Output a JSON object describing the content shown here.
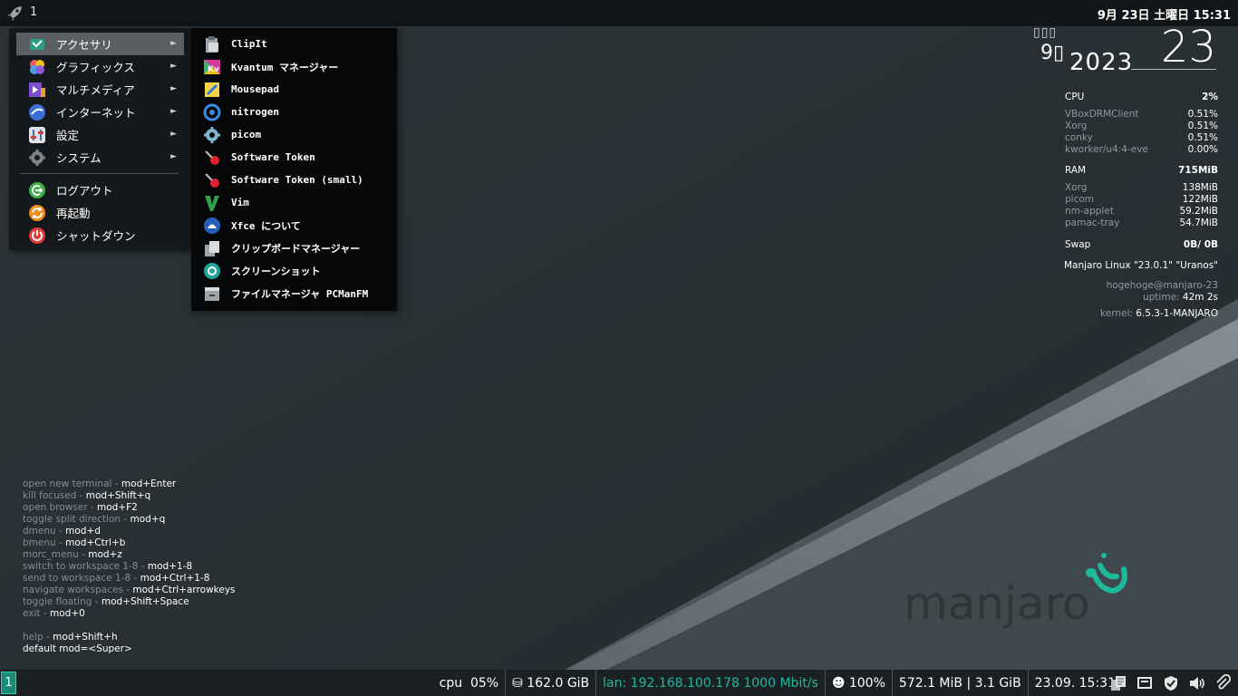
{
  "top_panel": {
    "workspace": "1",
    "clock": "9月 23日 土曜日 15:31"
  },
  "main_menu": {
    "categories": [
      {
        "label": "アクセサリ",
        "icon": "accessories-icon"
      },
      {
        "label": "グラフィックス",
        "icon": "graphics-icon"
      },
      {
        "label": "マルチメディア",
        "icon": "multimedia-icon"
      },
      {
        "label": "インターネット",
        "icon": "internet-icon"
      },
      {
        "label": "設定",
        "icon": "settings-icon"
      },
      {
        "label": "システム",
        "icon": "system-icon"
      }
    ],
    "actions": [
      {
        "label": "ログアウト",
        "icon": "logout-icon"
      },
      {
        "label": "再起動",
        "icon": "restart-icon"
      },
      {
        "label": "シャットダウン",
        "icon": "shutdown-icon"
      }
    ],
    "arrow": "►"
  },
  "sub_menu": {
    "items": [
      {
        "label": "ClipIt",
        "icon": "clipit-icon"
      },
      {
        "label": "Kvantum マネージャー",
        "icon": "kvantum-icon"
      },
      {
        "label": "Mousepad",
        "icon": "mousepad-icon"
      },
      {
        "label": "nitrogen",
        "icon": "nitrogen-icon"
      },
      {
        "label": "picom",
        "icon": "picom-icon"
      },
      {
        "label": "Software Token",
        "icon": "software-token-icon"
      },
      {
        "label": "Software Token (small)",
        "icon": "software-token-small-icon"
      },
      {
        "label": "Vim",
        "icon": "vim-icon"
      },
      {
        "label": "Xfce について",
        "icon": "xfce-icon"
      },
      {
        "label": "クリップボードマネージャー",
        "icon": "clipboard-manager-icon"
      },
      {
        "label": "スクリーンショット",
        "icon": "screenshot-icon"
      },
      {
        "label": "ファイルマネージャ PCManFM",
        "icon": "file-manager-icon"
      }
    ]
  },
  "conky": {
    "date_boxes": "▯▯▯",
    "month": "9▯",
    "year": "2023",
    "day": "23",
    "cpu": {
      "label": "CPU",
      "value": "2%",
      "procs": [
        {
          "name": "VBoxDRMClient",
          "value": "0.51%"
        },
        {
          "name": "Xorg",
          "value": "0.51%"
        },
        {
          "name": "conky",
          "value": "0.51%"
        },
        {
          "name": "kworker/u4:4-eve",
          "value": "0.00%"
        }
      ]
    },
    "ram": {
      "label": "RAM",
      "value": "715MiB",
      "procs": [
        {
          "name": "Xorg",
          "value": "138MiB"
        },
        {
          "name": "picom",
          "value": "122MiB"
        },
        {
          "name": "nm-applet",
          "value": "59.2MiB"
        },
        {
          "name": "pamac-tray",
          "value": "54.7MiB"
        }
      ]
    },
    "swap": {
      "label": "Swap",
      "value": "0B/ 0B"
    },
    "os": "Manjaro Linux \"23.0.1\" \"Uranos\"",
    "user": "hogehoge@manjaro-23",
    "uptime_label": "uptime:",
    "uptime": "42m 2s",
    "kernel_label": "kernel:",
    "kernel": "6.5.3-1-MANJARO"
  },
  "help": {
    "lines": [
      {
        "k": "open new terminal - ",
        "v": "mod+Enter"
      },
      {
        "k": "kill focused - ",
        "v": "mod+Shift+q"
      },
      {
        "k": "open browser - ",
        "v": "mod+F2"
      },
      {
        "k": "toggle split direction - ",
        "v": "mod+q"
      },
      {
        "k": "dmenu - ",
        "v": "mod+d"
      },
      {
        "k": "bmenu - ",
        "v": "mod+Ctrl+b"
      },
      {
        "k": "morc_menu - ",
        "v": "mod+z"
      },
      {
        "k": "switch to workspace 1-8 - ",
        "v": "mod+1-8"
      },
      {
        "k": "send to workspace 1-8 - ",
        "v": "mod+Ctrl+1-8"
      },
      {
        "k": "navigate workspaces - ",
        "v": "mod+Ctrl+arrowkeys"
      },
      {
        "k": "toggle floating - ",
        "v": "mod+Shift+Space"
      },
      {
        "k": "exit - ",
        "v": "mod+0"
      },
      {
        "k": "",
        "v": ""
      },
      {
        "k": "help - ",
        "v": "mod+Shift+h"
      },
      {
        "k": "",
        "v": "default mod=<Super>"
      }
    ]
  },
  "bottom_bar": {
    "workspace": "1",
    "cpu": "cpu  05%",
    "disk": "⛁ 162.0 GiB",
    "lan": "lan: 192.168.100.178 1000 Mbit/s",
    "battery": "☻ 100%",
    "memory": "572.1 MiB | 3.1 GiB",
    "datetime": "23.09. 15:31",
    "tray": [
      "clipboard-icon",
      "network-icon",
      "shield-icon",
      "volume-icon",
      "paperclip-icon"
    ]
  },
  "wallpaper": {
    "logo_text": "manjaro",
    "accent": "#1fb99a"
  },
  "colors": {
    "panel": "#121518",
    "menu": "#16191c",
    "submenu": "#060708",
    "selected": "#5a5f63",
    "workspace": "#1b8b78",
    "lan": "#1fb7a0"
  }
}
